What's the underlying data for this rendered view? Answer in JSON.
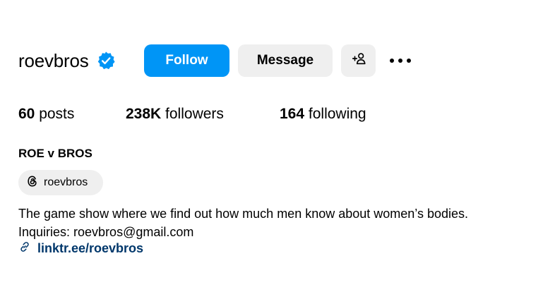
{
  "profile": {
    "username": "roevbros",
    "verified": true,
    "display_name": "ROE v BROS",
    "threads_handle": "roevbros",
    "bio_line1": "The game show where we find out how much men know about women’s bodies.",
    "bio_line2": "Inquiries: roevbros@gmail.com",
    "link": "linktr.ee/roevbros"
  },
  "actions": {
    "follow_label": "Follow",
    "message_label": "Message"
  },
  "stats": {
    "posts_count": "60",
    "posts_label": "posts",
    "followers_count": "238K",
    "followers_label": "followers",
    "following_count": "164",
    "following_label": "following"
  },
  "icons": {
    "verified": "verified-badge-icon",
    "add_user": "add-person-icon",
    "more": "more-options-icon",
    "threads": "threads-logo-icon",
    "link": "link-icon"
  },
  "colors": {
    "accent": "#0095f6",
    "secondary_button": "#efefef",
    "link": "#00376b"
  }
}
